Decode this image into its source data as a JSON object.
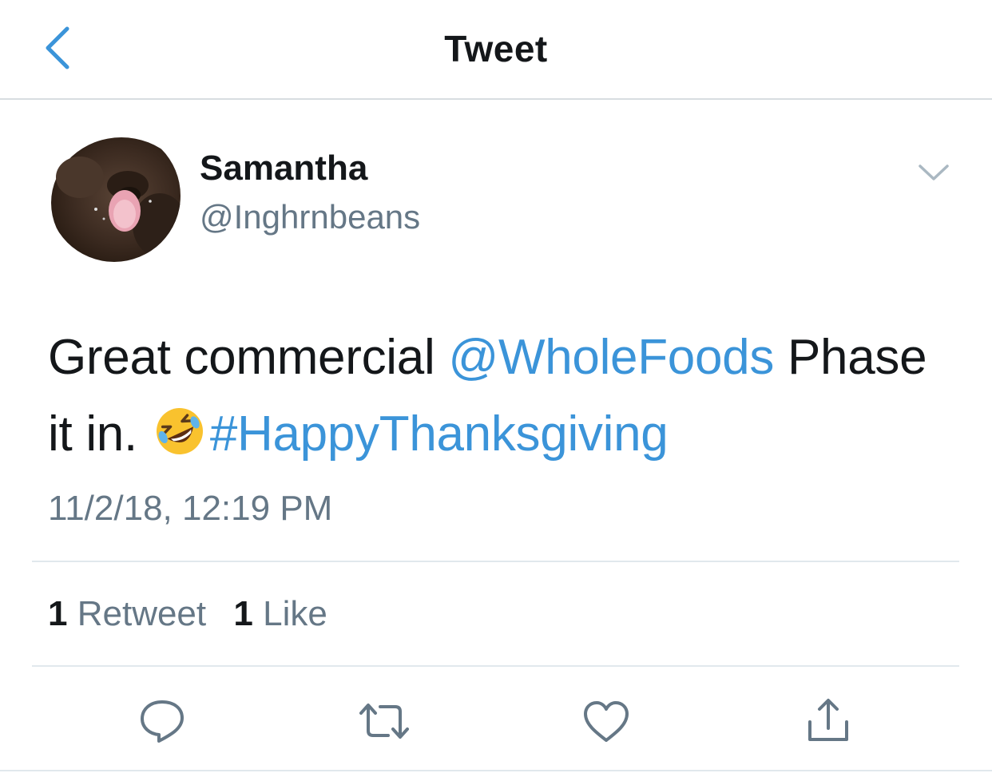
{
  "nav": {
    "title": "Tweet"
  },
  "tweet": {
    "author_name": "Samantha",
    "author_handle": "@Inghrnbeans",
    "text_before_mention": "Great commercial ",
    "mention": "@WholeFoods",
    "text_after_mention": " Phase it in. ",
    "emoji_name": "rolling-on-floor-laughing",
    "hashtag": "#HappyThanksgiving",
    "timestamp": "11/2/18, 12:19 PM"
  },
  "stats": {
    "retweet_count": "1",
    "retweet_label": "Retweet",
    "like_count": "1",
    "like_label": "Like"
  },
  "icons": {
    "back": "chevron-left-icon",
    "menu": "chevron-down-icon",
    "reply": "reply-bubble-icon",
    "retweet": "retweet-icon",
    "like": "heart-icon",
    "share": "share-icon"
  },
  "colors": {
    "accent": "#3b94d9",
    "text": "#14171a",
    "secondary": "#657786",
    "divider": "#e1e8ed"
  }
}
